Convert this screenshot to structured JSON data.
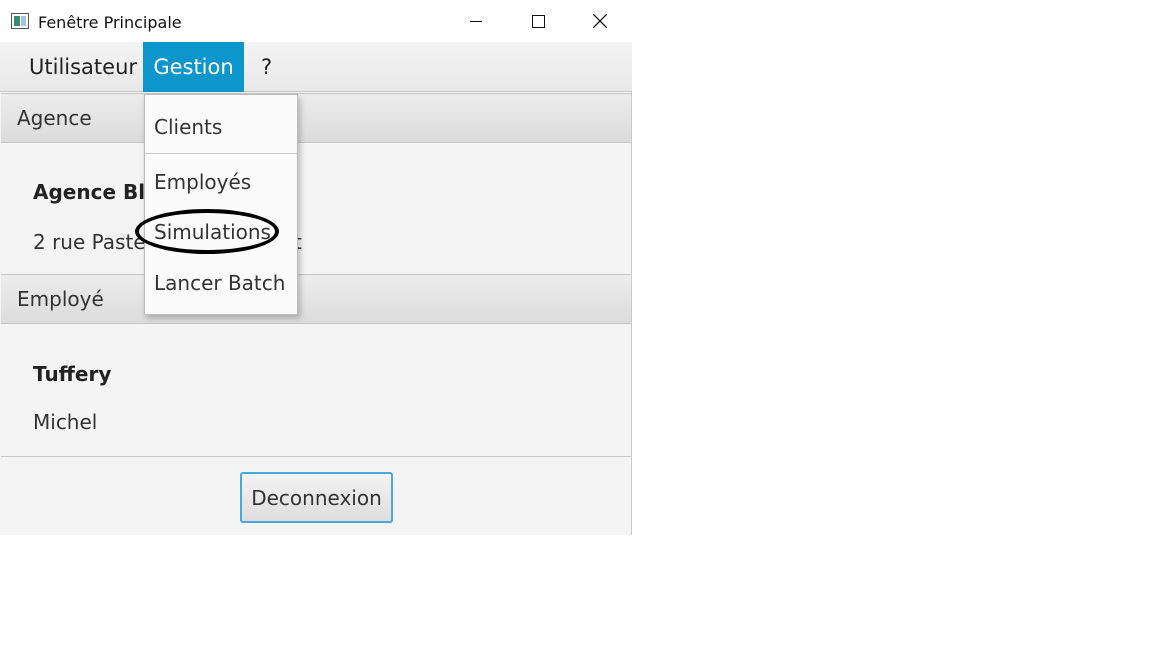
{
  "window": {
    "title": "Fenêtre Principale"
  },
  "menubar": {
    "items": [
      {
        "label": "Utilisateur"
      },
      {
        "label": "Gestion"
      },
      {
        "label": "?"
      }
    ]
  },
  "dropdown": {
    "items": [
      {
        "label": "Clients"
      },
      {
        "label": "Employés"
      },
      {
        "label": "Simulations"
      },
      {
        "label": "Lancer Batch"
      }
    ]
  },
  "agence": {
    "header": "Agence",
    "name": "Agence Bla",
    "address_start": "2 rue Paste",
    "address_end": "t"
  },
  "employe": {
    "header": "Employé",
    "lastname": "Tuffery",
    "firstname": "Michel"
  },
  "footer": {
    "logout_label": "Deconnexion"
  },
  "colors": {
    "menu_active": "#0d96cc",
    "button_border": "#4ba8d8"
  }
}
